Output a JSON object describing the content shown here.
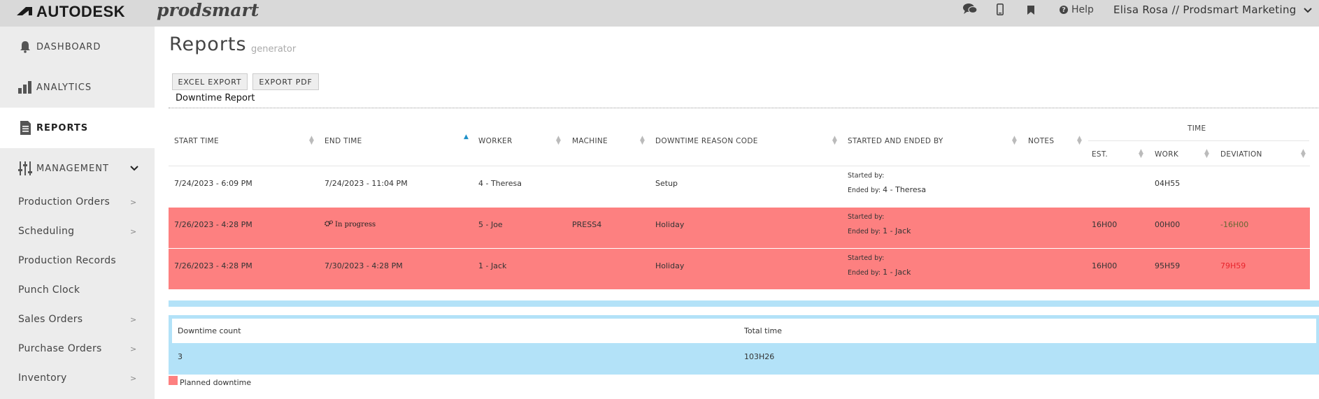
{
  "topbar": {
    "brand": "AUTODESK",
    "product": "prodsmart",
    "help": "Help",
    "user": "Elisa Rosa // Prodsmart Marketing",
    "icons": [
      "chat-icon",
      "mobile-icon",
      "bookmark-icon",
      "help-icon",
      "chevron-down-icon"
    ]
  },
  "sidebar": {
    "main": [
      {
        "label": "DASHBOARD",
        "icon": "bell-icon"
      },
      {
        "label": "ANALYTICS",
        "icon": "bar-chart-icon"
      },
      {
        "label": "REPORTS",
        "icon": "document-icon"
      },
      {
        "label": "MANAGEMENT",
        "icon": "sliders-icon"
      }
    ],
    "sub": [
      {
        "label": "Production Orders",
        "arrow": true
      },
      {
        "label": "Scheduling",
        "arrow": true
      },
      {
        "label": "Production Records",
        "arrow": false
      },
      {
        "label": "Punch Clock",
        "arrow": false
      },
      {
        "label": "Sales Orders",
        "arrow": true
      },
      {
        "label": "Purchase Orders",
        "arrow": true
      },
      {
        "label": "Inventory",
        "arrow": true
      }
    ]
  },
  "page": {
    "title": "Reports",
    "subtitle": "generator",
    "excel_btn": "EXCEL EXPORT",
    "pdf_btn": "EXPORT PDF",
    "report_name": "Downtime Report"
  },
  "table": {
    "headers": {
      "start": "START TIME",
      "end": "END TIME",
      "worker": "WORKER",
      "machine": "MACHINE",
      "reason": "DOWNTIME REASON CODE",
      "started_ended": "STARTED AND ENDED BY",
      "notes": "NOTES",
      "time": "TIME",
      "est": "EST.",
      "work": "WORK",
      "deviation": "DEVIATION"
    },
    "rows": [
      {
        "start": "7/24/2023 - 6:09 PM",
        "end": "7/24/2023 - 11:04 PM",
        "worker": "4 - Theresa",
        "machine": "",
        "reason": "Setup",
        "started_label": "Started by:",
        "started_by": "",
        "ended_label": "Ended by:",
        "ended_by": "4 - Theresa",
        "notes": "",
        "est": "",
        "work": "04H55",
        "deviation": "",
        "planned": false
      },
      {
        "start": "7/26/2023 - 4:28 PM",
        "end": "In progress",
        "worker": "5 - Joe",
        "machine": "PRESS4",
        "reason": "Holiday",
        "started_label": "Started by:",
        "started_by": "",
        "ended_label": "Ended by:",
        "ended_by": "1 - Jack",
        "notes": "",
        "est": "16H00",
        "work": "00H00",
        "deviation": "-16H00",
        "planned": true
      },
      {
        "start": "7/26/2023 - 4:28 PM",
        "end": "7/30/2023 - 4:28 PM",
        "worker": "1 - Jack",
        "machine": "",
        "reason": "Holiday",
        "started_label": "Started by:",
        "started_by": "",
        "ended_label": "Ended by:",
        "ended_by": "1 - Jack",
        "notes": "",
        "est": "16H00",
        "work": "95H59",
        "deviation": "79H59",
        "planned": true
      }
    ]
  },
  "summary": {
    "count_label": "Downtime count",
    "total_label": "Total time",
    "count": "3",
    "total": "103H26"
  },
  "legend": {
    "label": "Planned downtime",
    "color": "#fd8080"
  }
}
